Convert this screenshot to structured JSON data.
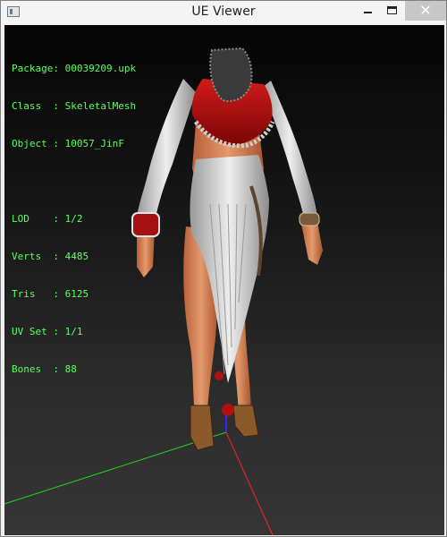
{
  "window": {
    "title": "UE Viewer"
  },
  "controls": {
    "minimize": "—",
    "maximize": "☐",
    "close": "✕"
  },
  "info": {
    "package": {
      "label": "Package",
      "value": "00039209.upk"
    },
    "class": {
      "label": "Class  ",
      "value": "SkeletalMesh"
    },
    "object": {
      "label": "Object ",
      "value": "10057_JinF"
    },
    "lod": {
      "label": "LOD    ",
      "value": "1/2"
    },
    "verts": {
      "label": "Verts  ",
      "value": "4485"
    },
    "tris": {
      "label": "Tris   ",
      "value": "6125"
    },
    "uvset": {
      "label": "UV Set ",
      "value": "1/1"
    },
    "bones": {
      "label": "Bones  ",
      "value": "88"
    }
  },
  "colors": {
    "info_text": "#5cff5c",
    "axis_x": "#ff2020",
    "axis_y": "#1bd21b",
    "axis_z": "#2a2aff",
    "dress_red": "#b01010",
    "dress_white": "#dcdcdc",
    "skin": "#d9875a"
  },
  "icons": {
    "app": "ue-viewer-app-icon",
    "minimize": "minimize-icon",
    "maximize": "maximize-icon",
    "close": "close-icon"
  }
}
